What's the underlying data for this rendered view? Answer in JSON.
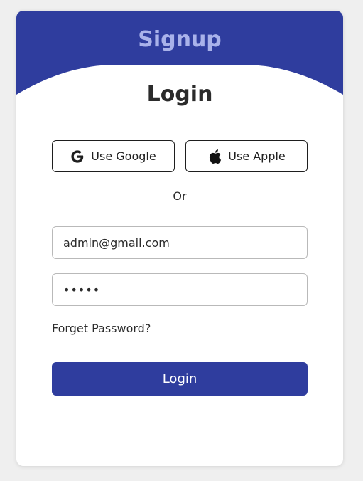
{
  "header": {
    "signup_label": "Signup"
  },
  "form": {
    "title": "Login",
    "google_label": "Use Google",
    "apple_label": "Use Apple",
    "divider_text": "Or",
    "email_value": "admin@gmail.com",
    "password_value": "•••••",
    "forgot_label": "Forget Password?",
    "submit_label": "Login"
  },
  "colors": {
    "brand": "#2f3d9e",
    "signup_text": "#a9b2ea",
    "background": "#efefef"
  },
  "icons": {
    "google": "google-icon",
    "apple": "apple-icon"
  }
}
